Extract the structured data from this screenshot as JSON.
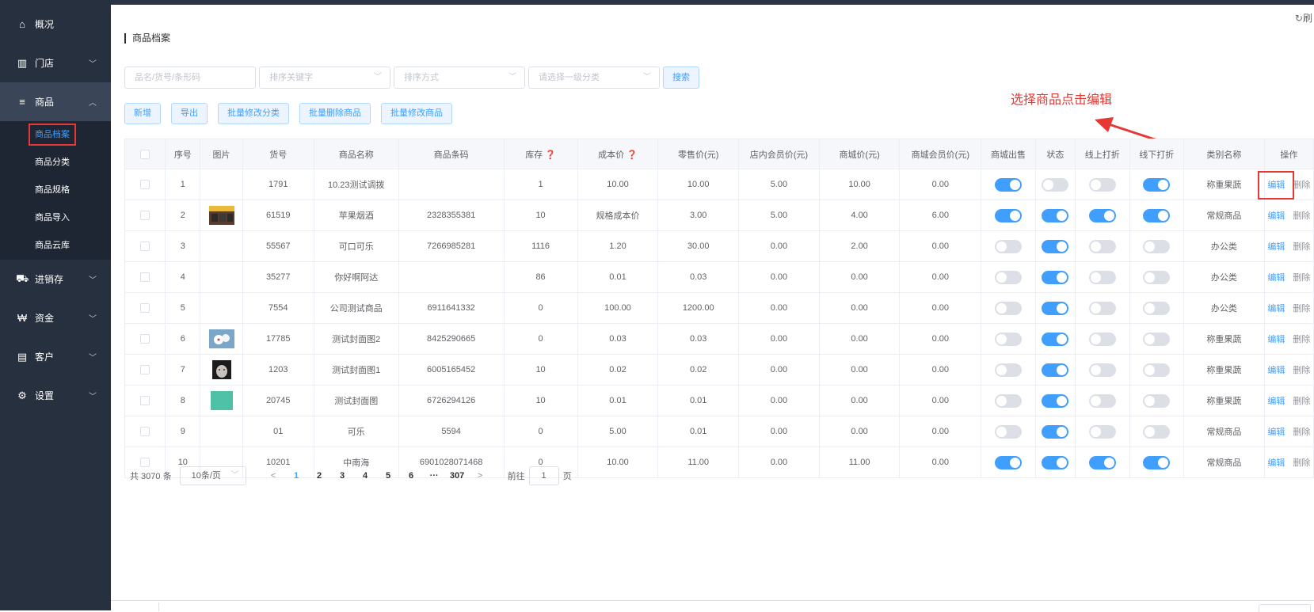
{
  "sidebar": {
    "items": [
      {
        "label": "概况",
        "icon": "home-icon"
      },
      {
        "label": "门店",
        "icon": "store-icon"
      },
      {
        "label": "商品",
        "icon": "menu-icon"
      },
      {
        "label": "进销存",
        "icon": "truck-icon"
      },
      {
        "label": "资金",
        "icon": "won-icon"
      },
      {
        "label": "客户",
        "icon": "idcard-icon"
      },
      {
        "label": "设置",
        "icon": "gear-icon"
      }
    ],
    "sub_items": [
      "商品档案",
      "商品分类",
      "商品规格",
      "商品导入",
      "商品云库"
    ]
  },
  "header": {
    "refresh_label": "刷",
    "page_title": "商品档案"
  },
  "filters": {
    "search_placeholder": "品名/货号/条形码",
    "sort_key_placeholder": "排序关键字",
    "sort_order_placeholder": "排序方式",
    "category_placeholder": "请选择一级分类",
    "search_button": "搜索"
  },
  "toolbar": {
    "add": "新增",
    "export": "导出",
    "batch_category": "批量修改分类",
    "batch_delete": "批量删除商品",
    "batch_edit": "批量修改商品"
  },
  "annotation": "选择商品点击编辑",
  "table": {
    "columns": [
      "序号",
      "图片",
      "货号",
      "商品名称",
      "商品条码",
      "库存",
      "成本价",
      "零售价(元)",
      "店内会员价(元)",
      "商城价(元)",
      "商城会员价(元)",
      "商城出售",
      "状态",
      "线上打折",
      "线下打折",
      "类别名称",
      "操作"
    ],
    "edit_label": "编辑",
    "delete_label": "删除",
    "rows": [
      {
        "no": "1",
        "sku": "1791",
        "name": "10.23测试调拨",
        "barcode": "",
        "stock": "1",
        "cost": "10.00",
        "retail": "10.00",
        "member": "5.00",
        "mall": "10.00",
        "mall_member": "0.00",
        "mall_sale": true,
        "status": false,
        "online_disc": false,
        "offline_disc": true,
        "category": "称重果蔬",
        "image": ""
      },
      {
        "no": "2",
        "sku": "61519",
        "name": "苹果烟酒",
        "barcode": "2328355381",
        "stock": "10",
        "cost": "规格成本价",
        "retail": "3.00",
        "member": "5.00",
        "mall": "4.00",
        "mall_member": "6.00",
        "mall_sale": true,
        "status": true,
        "online_disc": true,
        "offline_disc": true,
        "category": "常规商品",
        "image": "storefront"
      },
      {
        "no": "3",
        "sku": "55567",
        "name": "可口可乐",
        "barcode": "7266985281",
        "stock": "1116",
        "cost": "1.20",
        "retail": "30.00",
        "member": "0.00",
        "mall": "2.00",
        "mall_member": "0.00",
        "mall_sale": false,
        "status": true,
        "online_disc": false,
        "offline_disc": false,
        "category": "办公类",
        "image": ""
      },
      {
        "no": "4",
        "sku": "35277",
        "name": "你好啊阿达",
        "barcode": "",
        "stock": "86",
        "cost": "0.01",
        "retail": "0.03",
        "member": "0.00",
        "mall": "0.00",
        "mall_member": "0.00",
        "mall_sale": false,
        "status": true,
        "online_disc": false,
        "offline_disc": false,
        "category": "办公类",
        "image": ""
      },
      {
        "no": "5",
        "sku": "7554",
        "name": "公司测试商品",
        "barcode": "6911641332",
        "stock": "0",
        "cost": "100.00",
        "retail": "1200.00",
        "member": "0.00",
        "mall": "0.00",
        "mall_member": "0.00",
        "mall_sale": false,
        "status": true,
        "online_disc": false,
        "offline_disc": false,
        "category": "办公类",
        "image": ""
      },
      {
        "no": "6",
        "sku": "17785",
        "name": "测试封面图2",
        "barcode": "8425290665",
        "stock": "0",
        "cost": "0.03",
        "retail": "0.03",
        "member": "0.00",
        "mall": "0.00",
        "mall_member": "0.00",
        "mall_sale": false,
        "status": true,
        "online_disc": false,
        "offline_disc": false,
        "category": "称重果蔬",
        "image": "balls"
      },
      {
        "no": "7",
        "sku": "1203",
        "name": "测试封面图1",
        "barcode": "6005165452",
        "stock": "10",
        "cost": "0.02",
        "retail": "0.02",
        "member": "0.00",
        "mall": "0.00",
        "mall_member": "0.00",
        "mall_sale": false,
        "status": true,
        "online_disc": false,
        "offline_disc": false,
        "category": "称重果蔬",
        "image": "cat"
      },
      {
        "no": "8",
        "sku": "20745",
        "name": "测试封面图",
        "barcode": "6726294126",
        "stock": "10",
        "cost": "0.01",
        "retail": "0.01",
        "member": "0.00",
        "mall": "0.00",
        "mall_member": "0.00",
        "mall_sale": false,
        "status": true,
        "online_disc": false,
        "offline_disc": false,
        "category": "称重果蔬",
        "image": "teal"
      },
      {
        "no": "9",
        "sku": "01",
        "name": "可乐",
        "barcode": "5594",
        "stock": "0",
        "cost": "5.00",
        "retail": "0.01",
        "member": "0.00",
        "mall": "0.00",
        "mall_member": "0.00",
        "mall_sale": false,
        "status": true,
        "online_disc": false,
        "offline_disc": false,
        "category": "常规商品",
        "image": ""
      },
      {
        "no": "10",
        "sku": "10201",
        "name": "中南海",
        "barcode": "6901028071468",
        "stock": "0",
        "cost": "10.00",
        "retail": "11.00",
        "member": "0.00",
        "mall": "11.00",
        "mall_member": "0.00",
        "mall_sale": true,
        "status": true,
        "online_disc": true,
        "offline_disc": true,
        "category": "常规商品",
        "image": ""
      }
    ]
  },
  "pagination": {
    "total": "共 3070 条",
    "page_size": "10条/页",
    "pages": [
      "1",
      "2",
      "3",
      "4",
      "5",
      "6",
      "···",
      "307"
    ],
    "prev": "<",
    "next": ">",
    "goto_label": "前往",
    "goto_value": "1",
    "page_unit": "页"
  },
  "colors": {
    "primary": "#409eff",
    "sidebar": "#27303f",
    "annotation": "#e53935"
  }
}
